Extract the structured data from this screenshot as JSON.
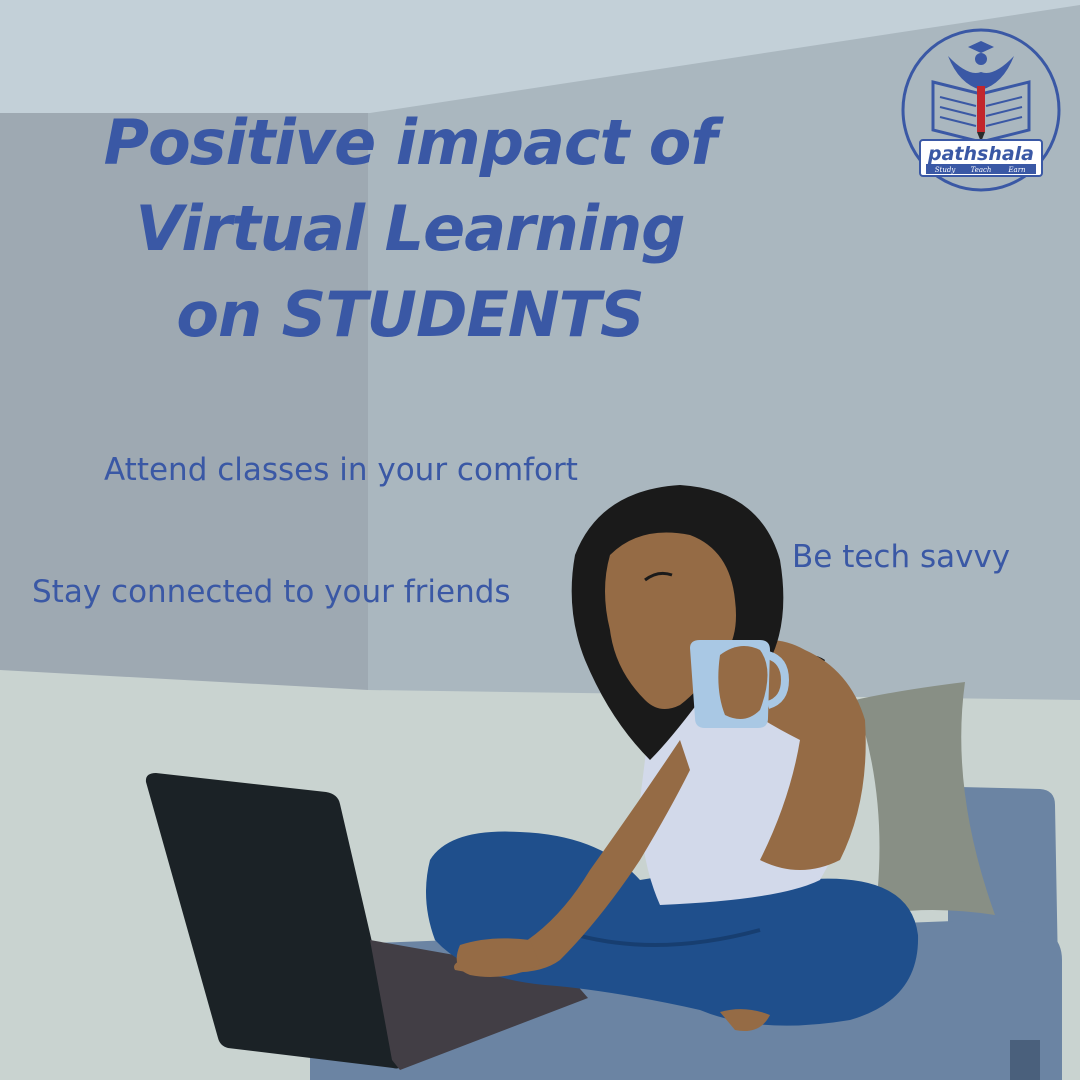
{
  "poster": {
    "title_lines": [
      "Positive impact of",
      "Virtual Learning",
      "on STUDENTS"
    ],
    "benefits": [
      "Attend classes in your comfort",
      "Stay connected to your friends",
      "Be tech savvy"
    ]
  },
  "logo": {
    "name": "pathshala",
    "tagline": [
      "Study",
      "Teach",
      "Earn"
    ]
  },
  "colors": {
    "text": "#3a58a5",
    "wall": "#aab7bf",
    "sofa": "#6884a0",
    "jeans": "#1d4f8d",
    "hair": "#1a1a1a",
    "skin": "#956b45",
    "laptop": "#1b2226"
  }
}
